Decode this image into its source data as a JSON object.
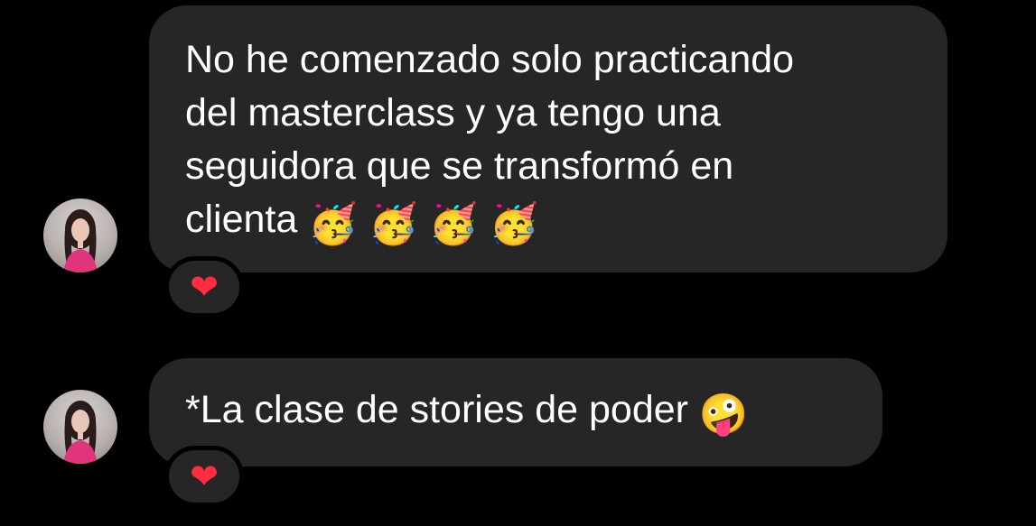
{
  "messages": [
    {
      "text": "No he comenzado solo practicando\ndel masterclass y ya tengo una\nseguidora que se transformó en\nclienta ",
      "emojis": [
        "🥳",
        "🥳",
        "🥳",
        "🥳"
      ],
      "reaction": "❤",
      "avatar_icon": "profile-photo"
    },
    {
      "text": "*La clase de stories de poder ",
      "emojis": [
        "🤪"
      ],
      "reaction": "❤",
      "avatar_icon": "profile-photo"
    }
  ],
  "colors": {
    "background": "#000000",
    "bubble": "#262626",
    "text": "#ffffff",
    "heart": "#ff2d3f"
  }
}
